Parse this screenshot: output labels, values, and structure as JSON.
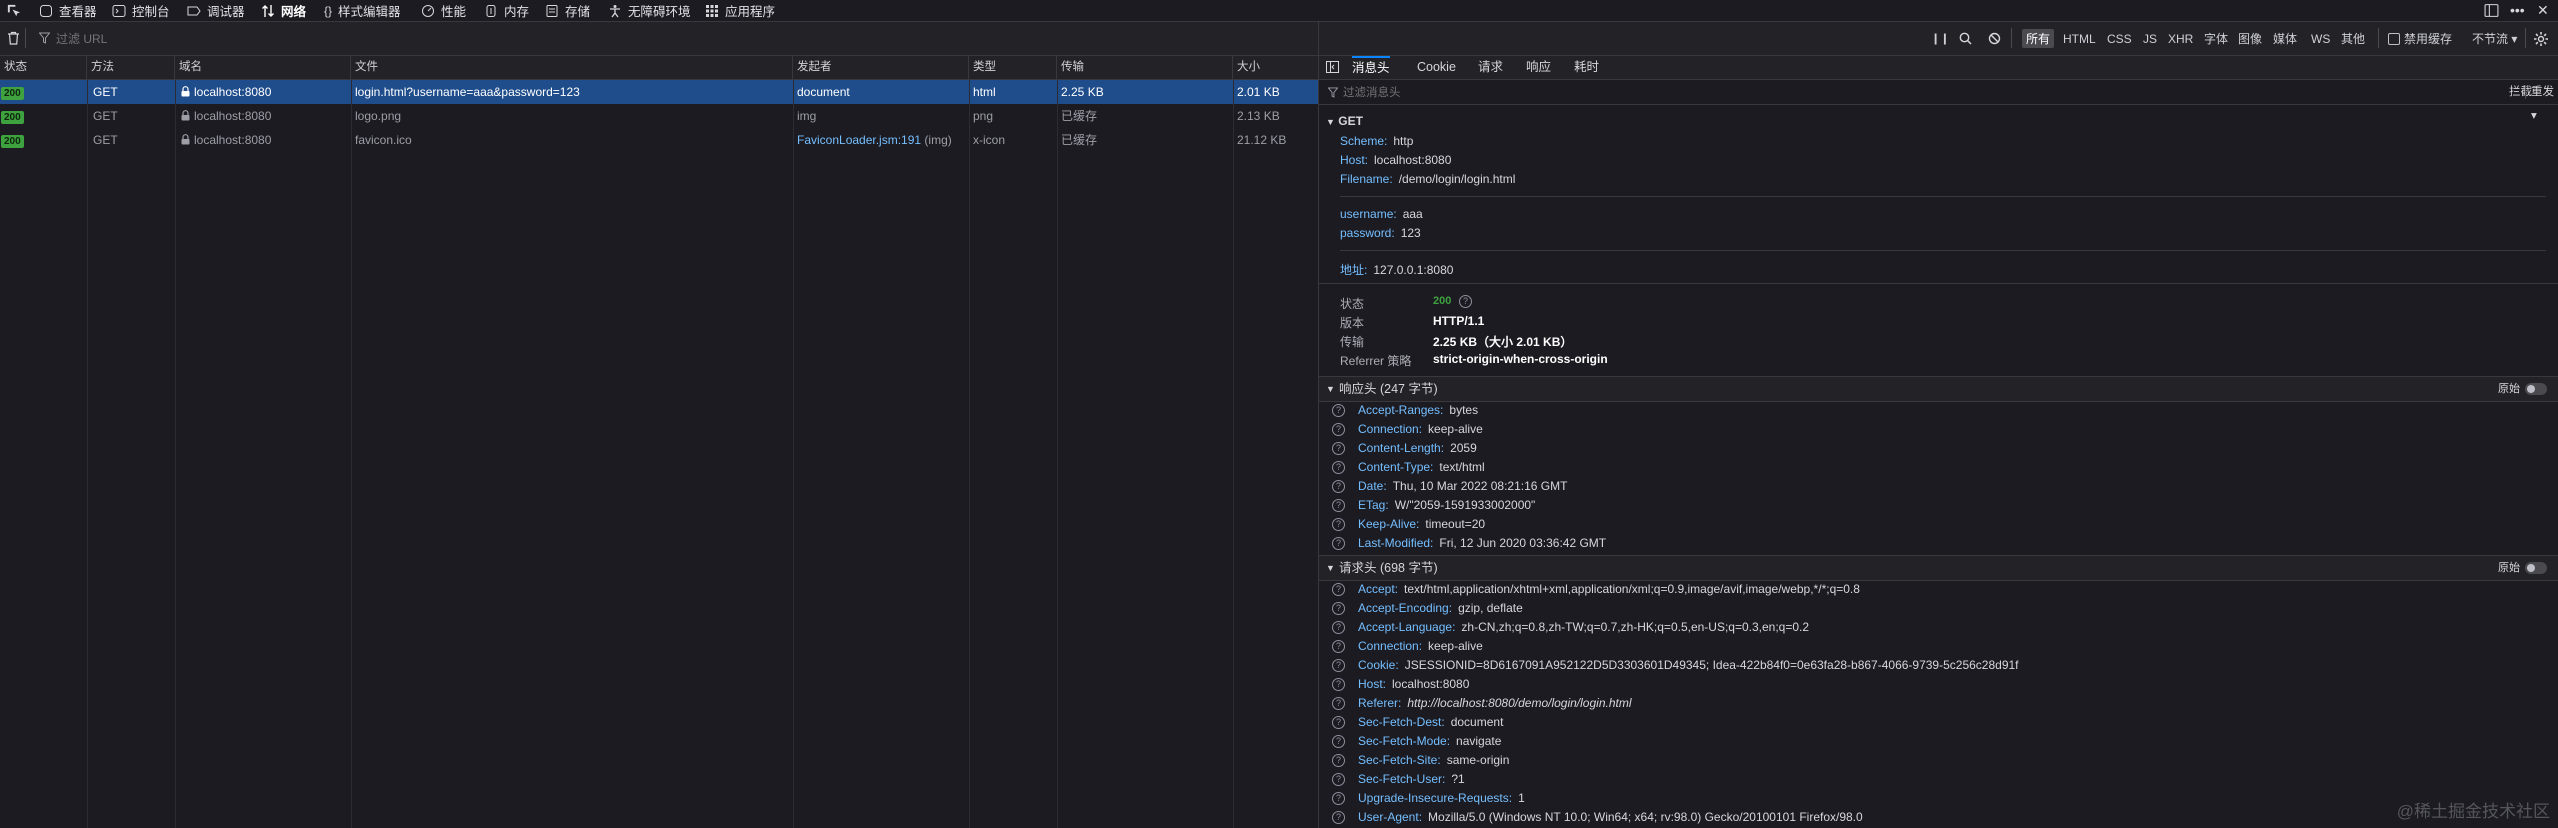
{
  "toolbar": {
    "tabs": [
      {
        "label": "查看器",
        "icon": "inspector-icon"
      },
      {
        "label": "控制台",
        "icon": "console-icon"
      },
      {
        "label": "调试器",
        "icon": "debugger-icon"
      },
      {
        "label": "网络",
        "icon": "network-arrows-icon"
      },
      {
        "label": "样式编辑器",
        "icon": "style-braces-icon"
      },
      {
        "label": "性能",
        "icon": "performance-gauge-icon"
      },
      {
        "label": "内存",
        "icon": "memory-icon"
      },
      {
        "label": "存储",
        "icon": "storage-icon"
      },
      {
        "label": "无障碍环境",
        "icon": "accessibility-icon"
      },
      {
        "label": "应用程序",
        "icon": "application-grid-icon"
      }
    ],
    "active_tab": "网络"
  },
  "filterbar": {
    "url_placeholder": "过滤 URL",
    "types": [
      "所有",
      "HTML",
      "CSS",
      "JS",
      "XHR",
      "字体",
      "图像",
      "媒体",
      "WS",
      "其他"
    ],
    "active_type": "所有",
    "disable_cache_label": "禁用缓存",
    "throttle_label": "不节流 ▾"
  },
  "table": {
    "headers": [
      "状态",
      "方法",
      "域名",
      "文件",
      "发起者",
      "类型",
      "传输",
      "大小"
    ],
    "rows": [
      {
        "status": "200",
        "method": "GET",
        "domain": "localhost:8080",
        "file": "login.html?username=aaa&password=123",
        "initiator": "document",
        "initiator_extra": "",
        "type": "html",
        "transferred": "2.25 KB",
        "size": "2.01 KB",
        "selected": true
      },
      {
        "status": "200",
        "method": "GET",
        "domain": "localhost:8080",
        "file": "logo.png",
        "initiator": "img",
        "initiator_extra": "",
        "type": "png",
        "transferred": "已缓存",
        "size": "2.13 KB",
        "selected": false
      },
      {
        "status": "200",
        "method": "GET",
        "domain": "localhost:8080",
        "file": "favicon.ico",
        "initiator": "FaviconLoader.jsm:191",
        "initiator_extra": "(img)",
        "type": "x-icon",
        "transferred": "已缓存",
        "size": "21.12 KB",
        "selected": false
      }
    ]
  },
  "detail": {
    "tabs": [
      "消息头",
      "Cookie",
      "请求",
      "响应",
      "耗时"
    ],
    "active_tab": "消息头",
    "filter_placeholder": "过滤消息头",
    "block_label": "拦截",
    "resend_label": "重发 ▾",
    "request_summary": {
      "method": "GET",
      "scheme_key": "Scheme:",
      "scheme": "http",
      "host_key": "Host:",
      "host": "localhost:8080",
      "filename_key": "Filename:",
      "filename": "/demo/login/login.html",
      "params": [
        {
          "key": "username:",
          "value": "aaa"
        },
        {
          "key": "password:",
          "value": "123"
        }
      ],
      "address_key": "地址:",
      "address": "127.0.0.1:8080"
    },
    "status_block": [
      {
        "label": "状态",
        "value": "200"
      },
      {
        "label": "版本",
        "value": "HTTP/1.1"
      },
      {
        "label": "传输",
        "value": "2.25 KB（大小 2.01 KB）"
      },
      {
        "label": "Referrer 策略",
        "value": "strict-origin-when-cross-origin"
      }
    ],
    "response_headers": {
      "title": "响应头 (247 字节)",
      "raw_label": "原始",
      "items": [
        {
          "key": "Accept-Ranges:",
          "value": "bytes"
        },
        {
          "key": "Connection:",
          "value": "keep-alive"
        },
        {
          "key": "Content-Length:",
          "value": "2059"
        },
        {
          "key": "Content-Type:",
          "value": "text/html"
        },
        {
          "key": "Date:",
          "value": "Thu, 10 Mar 2022 08:21:16 GMT"
        },
        {
          "key": "ETag:",
          "value": "W/\"2059-1591933002000\""
        },
        {
          "key": "Keep-Alive:",
          "value": "timeout=20"
        },
        {
          "key": "Last-Modified:",
          "value": "Fri, 12 Jun 2020 03:36:42 GMT"
        }
      ]
    },
    "request_headers": {
      "title": "请求头 (698 字节)",
      "raw_label": "原始",
      "items": [
        {
          "key": "Accept:",
          "value": "text/html,application/xhtml+xml,application/xml;q=0.9,image/avif,image/webp,*/*;q=0.8"
        },
        {
          "key": "Accept-Encoding:",
          "value": "gzip, deflate"
        },
        {
          "key": "Accept-Language:",
          "value": "zh-CN,zh;q=0.8,zh-TW;q=0.7,zh-HK;q=0.5,en-US;q=0.3,en;q=0.2"
        },
        {
          "key": "Connection:",
          "value": "keep-alive"
        },
        {
          "key": "Cookie:",
          "value": "JSESSIONID=8D6167091A952122D5D3303601D49345; Idea-422b84f0=0e63fa28-b867-4066-9739-5c256c28d91f"
        },
        {
          "key": "Host:",
          "value": "localhost:8080"
        },
        {
          "key": "Referer:",
          "value": "http://localhost:8080/demo/login/login.html"
        },
        {
          "key": "Sec-Fetch-Dest:",
          "value": "document"
        },
        {
          "key": "Sec-Fetch-Mode:",
          "value": "navigate"
        },
        {
          "key": "Sec-Fetch-Site:",
          "value": "same-origin"
        },
        {
          "key": "Sec-Fetch-User:",
          "value": "?1"
        },
        {
          "key": "Upgrade-Insecure-Requests:",
          "value": "1"
        },
        {
          "key": "User-Agent:",
          "value": "Mozilla/5.0 (Windows NT 10.0; Win64; x64; rv:98.0) Gecko/20100101 Firefox/98.0"
        }
      ]
    }
  },
  "watermark": "@稀土掘金技术社区",
  "colors": {
    "accent": "#0a84ff",
    "status_ok": "#3ea23e",
    "key_blue": "#75bfff",
    "selected_row": "#1f4d8c"
  }
}
